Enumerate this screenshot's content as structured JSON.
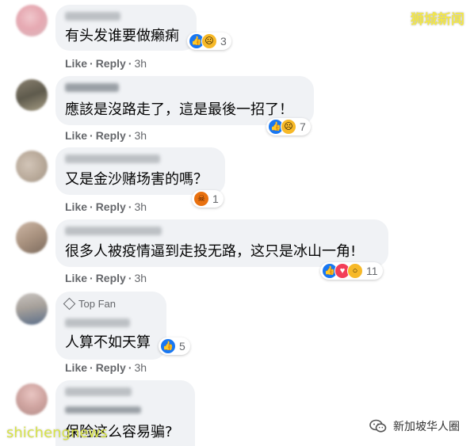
{
  "watermarks": {
    "top_right": "狮城新闻",
    "site": "shichengnews",
    "wechat_account": "新加坡华人圈"
  },
  "comments": [
    {
      "top_fan": null,
      "text": "有头发谁要做癞痢",
      "reactions": [
        "like",
        "sad"
      ],
      "reaction_count": "3",
      "like": "Like",
      "reply": "Reply",
      "time": "3h"
    },
    {
      "top_fan": null,
      "text": "應該是沒路走了，這是最後一招了！",
      "reactions": [
        "like",
        "sad"
      ],
      "reaction_count": "7",
      "like": "Like",
      "reply": "Reply",
      "time": "3h"
    },
    {
      "top_fan": null,
      "text": "又是金沙赌场害的嗎？",
      "reactions": [
        "angry"
      ],
      "reaction_count": "1",
      "like": "Like",
      "reply": "Reply",
      "time": "3h"
    },
    {
      "top_fan": null,
      "text": "很多人被疫情逼到走投无路，这只是冰山一角!",
      "reactions": [
        "like",
        "love",
        "wow"
      ],
      "reaction_count": "11",
      "like": "Like",
      "reply": "Reply",
      "time": "3h"
    },
    {
      "top_fan": "Top Fan",
      "text": "人算不如天算",
      "reactions": [
        "like"
      ],
      "reaction_count": "5",
      "like": "Like",
      "reply": "Reply",
      "time": "3h"
    },
    {
      "top_fan": null,
      "text": "保险这么容易骗?",
      "reactions": [],
      "reaction_count": "",
      "like": "",
      "reply": "",
      "time": ""
    }
  ],
  "colors": {
    "bubble": "#f0f2f5",
    "meta_text": "#65676b",
    "like_blue": "#1877f2",
    "sad_yellow": "#f7b928",
    "angry_orange": "#e9710f",
    "love_red": "#f33e58",
    "watermark_yellow": "#f2e64a"
  }
}
